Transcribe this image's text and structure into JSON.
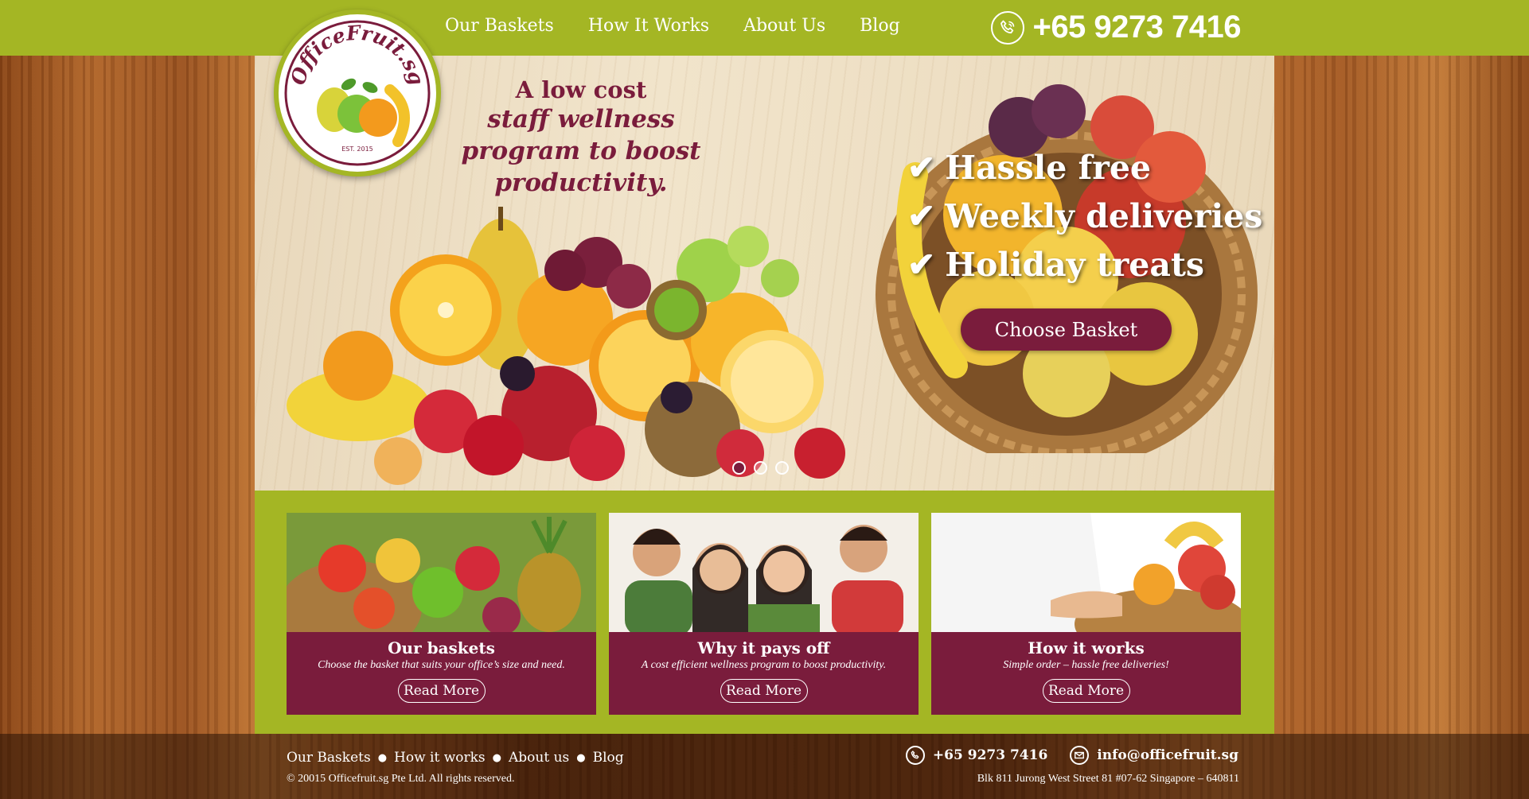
{
  "header": {
    "nav": [
      "Our Baskets",
      "How It Works",
      "About Us",
      "Blog"
    ],
    "phone": "+65 9273 7416",
    "phone_icon": "phone-icon"
  },
  "logo": {
    "text": "OfficeFruit.sg",
    "established": "EST. 2015"
  },
  "hero": {
    "tagline_line1": "A low cost",
    "tagline_line2": "staff wellness program to boost productivity.",
    "benefits": [
      "Hassle free",
      "Weekly deliveries",
      "Holiday treats"
    ],
    "cta_label": "Choose Basket",
    "slides": 3,
    "active_slide": 1
  },
  "cards": [
    {
      "title": "Our baskets",
      "description": "Choose the basket that suits your office’s size and need.",
      "button": "Read More"
    },
    {
      "title": "Why it pays off",
      "description": "A cost efficient wellness program to boost productivity.",
      "button": "Read More"
    },
    {
      "title": "How it works",
      "description": "Simple order – hassle free deliveries!",
      "button": "Read More"
    }
  ],
  "footer": {
    "nav": [
      "Our Baskets",
      "How it works",
      "About us",
      "Blog"
    ],
    "copyright": "© 20015 Officefruit.sg Pte Ltd. All rights reserved.",
    "phone": "+65 9273 7416",
    "email": "info@officefruit.sg",
    "address": "Blk 811 Jurong West Street 81 #07-62 Singapore – 640811"
  },
  "colors": {
    "brand_green": "#a4b624",
    "brand_maroon": "#7a1c3c"
  }
}
